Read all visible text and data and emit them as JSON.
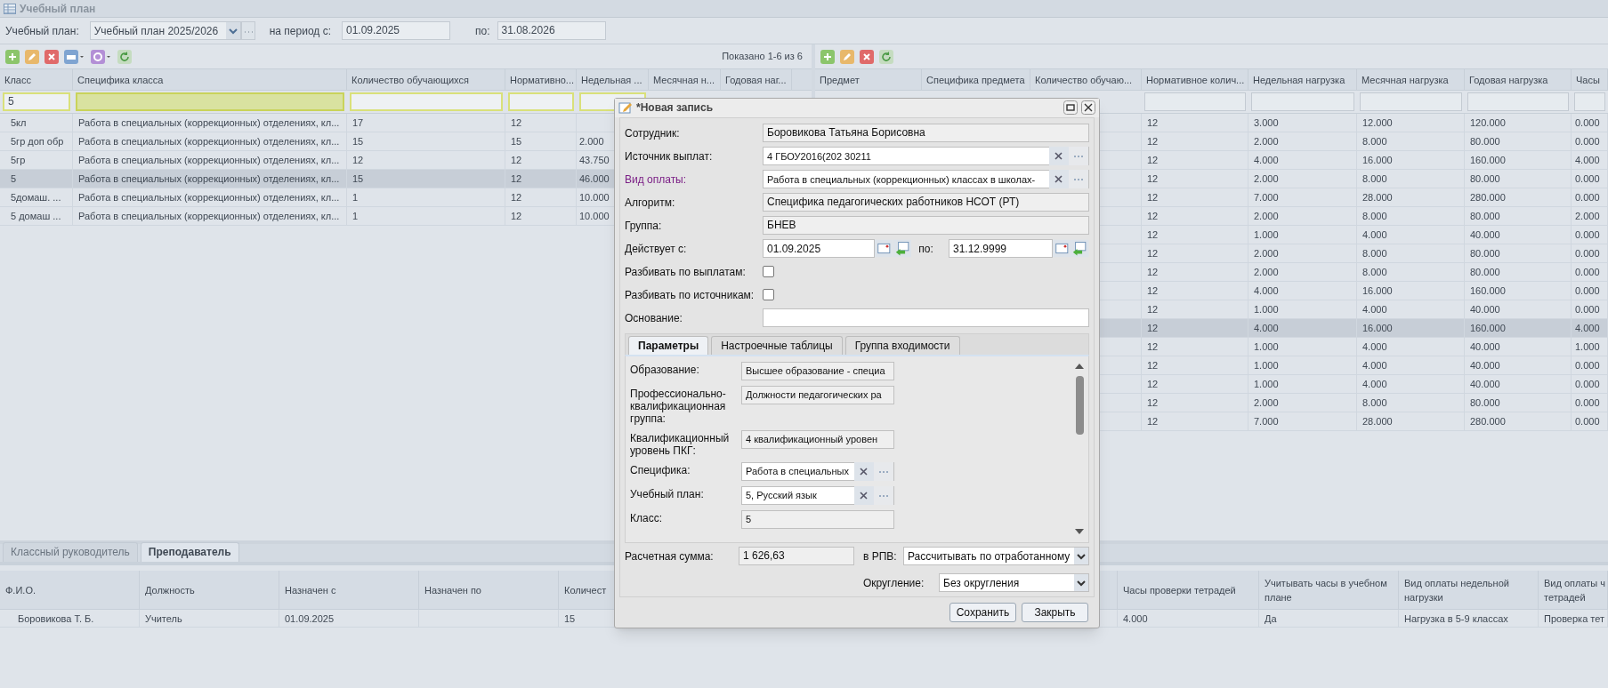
{
  "window": {
    "title": "Учебный план"
  },
  "filter": {
    "plan_label": "Учебный план:",
    "plan_value": "Учебный план 2025/2026",
    "period_label": "на период с:",
    "period_from": "01.09.2025",
    "to_label": "по:",
    "period_to": "31.08.2026"
  },
  "left_grid": {
    "paging": "Показано 1-6 из 6",
    "columns": [
      {
        "label": "Класс",
        "filter": "5",
        "focused": false
      },
      {
        "label": "Специфика класса",
        "focused": true
      },
      {
        "label": "Количество обучающихся",
        "focused": false
      },
      {
        "label": "Нормативно...",
        "focused": false
      },
      {
        "label": "Недельная ...",
        "focused": false
      },
      {
        "label": "Месячная н..."
      },
      {
        "label": "Годовая наг..."
      }
    ],
    "rows": [
      {
        "class": "5кл",
        "specifics": "Работа в специальных (коррекционных) отделениях, кл...",
        "students": "17",
        "normative": "12",
        "selected": false
      },
      {
        "class": "5гр доп обр",
        "specifics": "Работа в специальных (коррекционных) отделениях, кл...",
        "students": "15",
        "normative": "15",
        "weekly": "2.000",
        "selected": false
      },
      {
        "class": "5гр",
        "specifics": "Работа в специальных (коррекционных) отделениях, кл...",
        "students": "12",
        "normative": "12",
        "weekly": "43.750",
        "selected": false
      },
      {
        "class": "5",
        "specifics": "Работа в специальных (коррекционных) отделениях, кл...",
        "students": "15",
        "normative": "12",
        "weekly": "46.000",
        "selected": true
      },
      {
        "class": "5домаш. ...",
        "specifics": "Работа в специальных (коррекционных) отделениях, кл...",
        "students": "1",
        "normative": "12",
        "weekly": "10.000",
        "selected": false
      },
      {
        "class": "5 домаш ...",
        "specifics": "Работа в специальных (коррекционных) отделениях, кл...",
        "students": "1",
        "normative": "12",
        "weekly": "10.000",
        "selected": false
      }
    ]
  },
  "right_grid": {
    "columns": [
      "Предмет",
      "Специфика предмета",
      "Количество обучаю...",
      "Нормативное колич...",
      "Недельная нагрузка",
      "Месячная нагрузка",
      "Годовая нагрузка",
      "Часы"
    ],
    "rows": [
      {
        "normative": "12",
        "weekly": "3.000",
        "monthly": "12.000",
        "annual": "120.000",
        "hours": "0.000",
        "selected": false
      },
      {
        "normative": "12",
        "weekly": "2.000",
        "monthly": "8.000",
        "annual": "80.000",
        "hours": "0.000",
        "selected": false
      },
      {
        "normative": "12",
        "weekly": "4.000",
        "monthly": "16.000",
        "annual": "160.000",
        "hours": "4.000",
        "selected": false
      },
      {
        "normative": "12",
        "weekly": "2.000",
        "monthly": "8.000",
        "annual": "80.000",
        "hours": "0.000",
        "selected": false
      },
      {
        "normative": "12",
        "weekly": "7.000",
        "monthly": "28.000",
        "annual": "280.000",
        "hours": "0.000",
        "selected": false
      },
      {
        "normative": "12",
        "weekly": "2.000",
        "monthly": "8.000",
        "annual": "80.000",
        "hours": "2.000",
        "selected": false
      },
      {
        "normative": "12",
        "weekly": "1.000",
        "monthly": "4.000",
        "annual": "40.000",
        "hours": "0.000",
        "selected": false
      },
      {
        "normative": "12",
        "weekly": "2.000",
        "monthly": "8.000",
        "annual": "80.000",
        "hours": "0.000",
        "selected": false
      },
      {
        "normative": "12",
        "weekly": "2.000",
        "monthly": "8.000",
        "annual": "80.000",
        "hours": "0.000",
        "selected": false
      },
      {
        "normative": "12",
        "weekly": "4.000",
        "monthly": "16.000",
        "annual": "160.000",
        "hours": "0.000",
        "selected": false
      },
      {
        "normative": "12",
        "weekly": "1.000",
        "monthly": "4.000",
        "annual": "40.000",
        "hours": "0.000",
        "selected": false
      },
      {
        "normative": "12",
        "weekly": "4.000",
        "monthly": "16.000",
        "annual": "160.000",
        "hours": "4.000",
        "selected": true
      },
      {
        "normative": "12",
        "weekly": "1.000",
        "monthly": "4.000",
        "annual": "40.000",
        "hours": "1.000",
        "selected": false
      },
      {
        "normative": "12",
        "weekly": "1.000",
        "monthly": "4.000",
        "annual": "40.000",
        "hours": "0.000",
        "selected": false
      },
      {
        "normative": "12",
        "weekly": "1.000",
        "monthly": "4.000",
        "annual": "40.000",
        "hours": "0.000",
        "selected": false
      },
      {
        "normative": "12",
        "weekly": "2.000",
        "monthly": "8.000",
        "annual": "80.000",
        "hours": "0.000",
        "selected": false
      },
      {
        "normative": "12",
        "weekly": "7.000",
        "monthly": "28.000",
        "annual": "280.000",
        "hours": "0.000",
        "selected": false
      }
    ]
  },
  "bottom_tabs": [
    {
      "label": "Классный руководитель",
      "selected": false
    },
    {
      "label": "Преподаватель",
      "selected": true
    }
  ],
  "bottom_grid": {
    "columns": [
      "Ф.И.О.",
      "Должность",
      "Назначен с",
      "Назначен по",
      "Количест",
      "",
      "Часы проверки тетрадей",
      "Учитывать часы в учебном плане",
      "Вид оплаты недельной нагрузки",
      "Вид оплаты ч\nтетрадей"
    ],
    "rows": [
      {
        "full_name": "Боровикова Т. Б.",
        "position": "Учитель",
        "assigned_from": "01.09.2025",
        "count": "15",
        "notebook_hours": "4.000",
        "count_in_plan": "Да",
        "weekly_pay_type": "Нагрузка в 5-9 классах",
        "notebook_pay_type": "Проверка тет"
      }
    ]
  },
  "dialog": {
    "title": "*Новая запись",
    "fields": [
      {
        "kind": "readonly",
        "label": "Сотрудник:",
        "value": "Боровикова Татьяна Борисовна",
        "linked": false
      },
      {
        "kind": "lookup",
        "label": "Источник выплат:",
        "value": "4 ГБОУ2016(202 30211",
        "linked": false
      },
      {
        "kind": "lookup",
        "label": "Вид оплаты:",
        "value": "Работа в специальных (коррекционных) классах в школах-",
        "linked": true
      },
      {
        "kind": "readonly",
        "label": "Алгоритм:",
        "value": "Специфика педагогических работников НСОТ (РТ)",
        "linked": false
      },
      {
        "kind": "readonly",
        "label": "Группа:",
        "value": "БНЕВ",
        "linked": false
      },
      {
        "kind": "daterange",
        "label": "Действует с:",
        "value": "01.09.2025",
        "to_label": "по:",
        "to_value": "31.12.9999",
        "linked": false
      },
      {
        "kind": "checkbox",
        "label": "Разбивать по выплатам:",
        "checked": false,
        "linked": false
      },
      {
        "kind": "checkbox",
        "label": "Разбивать по источникам:",
        "checked": false,
        "linked": false
      },
      {
        "kind": "text",
        "label": "Основание:",
        "linked": false
      }
    ],
    "tabs": [
      {
        "label": "Параметры",
        "selected": true
      },
      {
        "label": "Настроечные таблицы",
        "selected": false
      },
      {
        "label": "Группа входимости",
        "selected": false
      }
    ],
    "params": [
      {
        "kind": "readonly",
        "label": "Образование:",
        "value": "Высшее образование - специа"
      },
      {
        "kind": "readonly",
        "label": "Профессионально-квалификационная группа:",
        "value": "Должности педагогических ра"
      },
      {
        "kind": "readonly",
        "label": "Квалификационный уровень ПКГ:",
        "value": "4 квалификационный уровен"
      },
      {
        "kind": "lookup",
        "label": "Специфика:",
        "value": "Работа в специальных"
      },
      {
        "kind": "lookup",
        "label": "Учебный план:",
        "value": "5, Русский язык"
      },
      {
        "kind": "readonly",
        "label": "Класс:",
        "value": "5"
      }
    ],
    "sum_label": "Расчетная сумма:",
    "sum_value": "1 626,63",
    "rpv_label": "в РПВ:",
    "rpv_value": "Рассчитывать по отработанному",
    "rounding_label": "Округление:",
    "rounding_value": "Без округления",
    "buttons": [
      "Сохранить",
      "Закрыть"
    ]
  }
}
